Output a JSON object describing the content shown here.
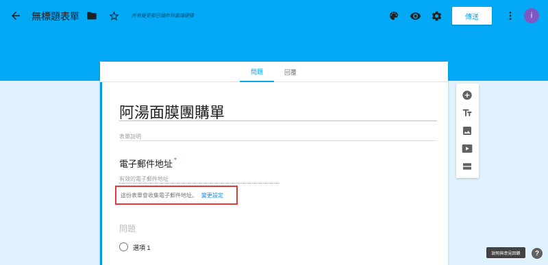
{
  "header": {
    "title": "無標題表單",
    "save_status": "所有變更都已儲存到雲端硬碟",
    "send_label": "傳送",
    "avatar_initial": "i",
    "accent_color": "#03a9f4"
  },
  "tabs": {
    "questions": "問題",
    "responses": "回覆"
  },
  "form": {
    "title": "阿湯面膜團購單",
    "description_placeholder": "表單說明",
    "email_label": "電子郵件地址",
    "required_marker": "*",
    "email_placeholder": "有效的電子郵件地址",
    "collect_note": "這份表單會收集電子郵件地址。",
    "change_settings": "變更設定",
    "question_title": "問題",
    "option_1": "選項 1"
  },
  "help": {
    "tooltip": "說明與意見回饋",
    "icon_label": "?"
  },
  "icons": [
    "back-icon",
    "folder-icon",
    "star-icon",
    "palette-icon",
    "eye-icon",
    "gear-icon",
    "more-icon",
    "add-circle-icon",
    "text-icon",
    "image-icon",
    "video-icon",
    "section-icon",
    "help-icon"
  ]
}
